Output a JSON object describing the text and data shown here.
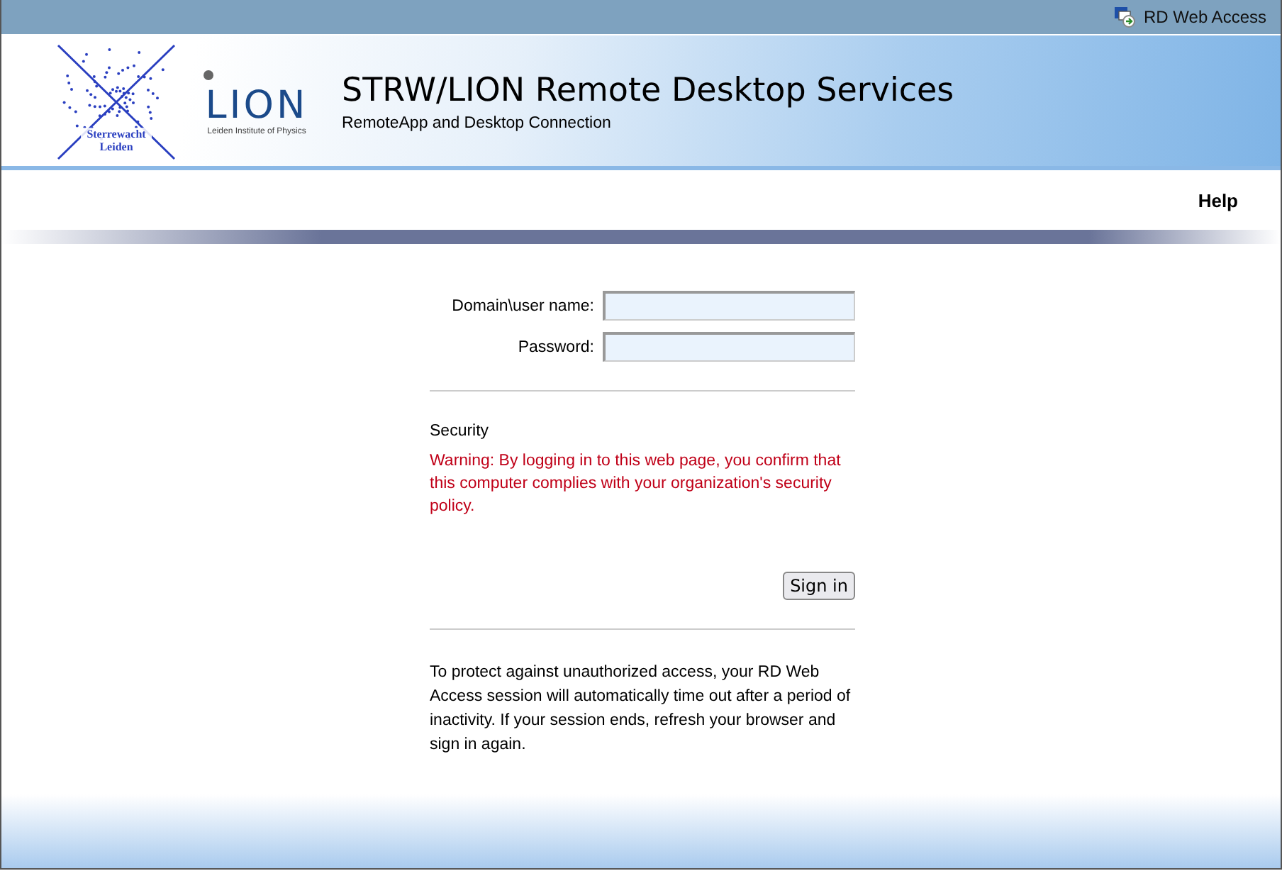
{
  "top_bar": {
    "title": "RD Web Access"
  },
  "header": {
    "logo_caption": "Sterrewacht\nLeiden",
    "logo_letters": "LION",
    "logo_subtitle": "Leiden Institute of Physics",
    "title": "STRW/LION Remote Desktop Services",
    "subtitle": "RemoteApp and Desktop Connection"
  },
  "nav": {
    "links": [
      "Help"
    ]
  },
  "form": {
    "fields": [
      {
        "label": "Domain\\user name:"
      },
      {
        "label": "Password:"
      }
    ],
    "security_heading": "Security",
    "warning": "Warning: By logging in to this web page, you confirm that this computer complies with your organization's security policy.",
    "button": "Sign in",
    "notice": "To protect against unauthorized access, your RD Web Access session will automatically time out after a period of inactivity. If your session ends, refresh your browser and sign in again."
  }
}
